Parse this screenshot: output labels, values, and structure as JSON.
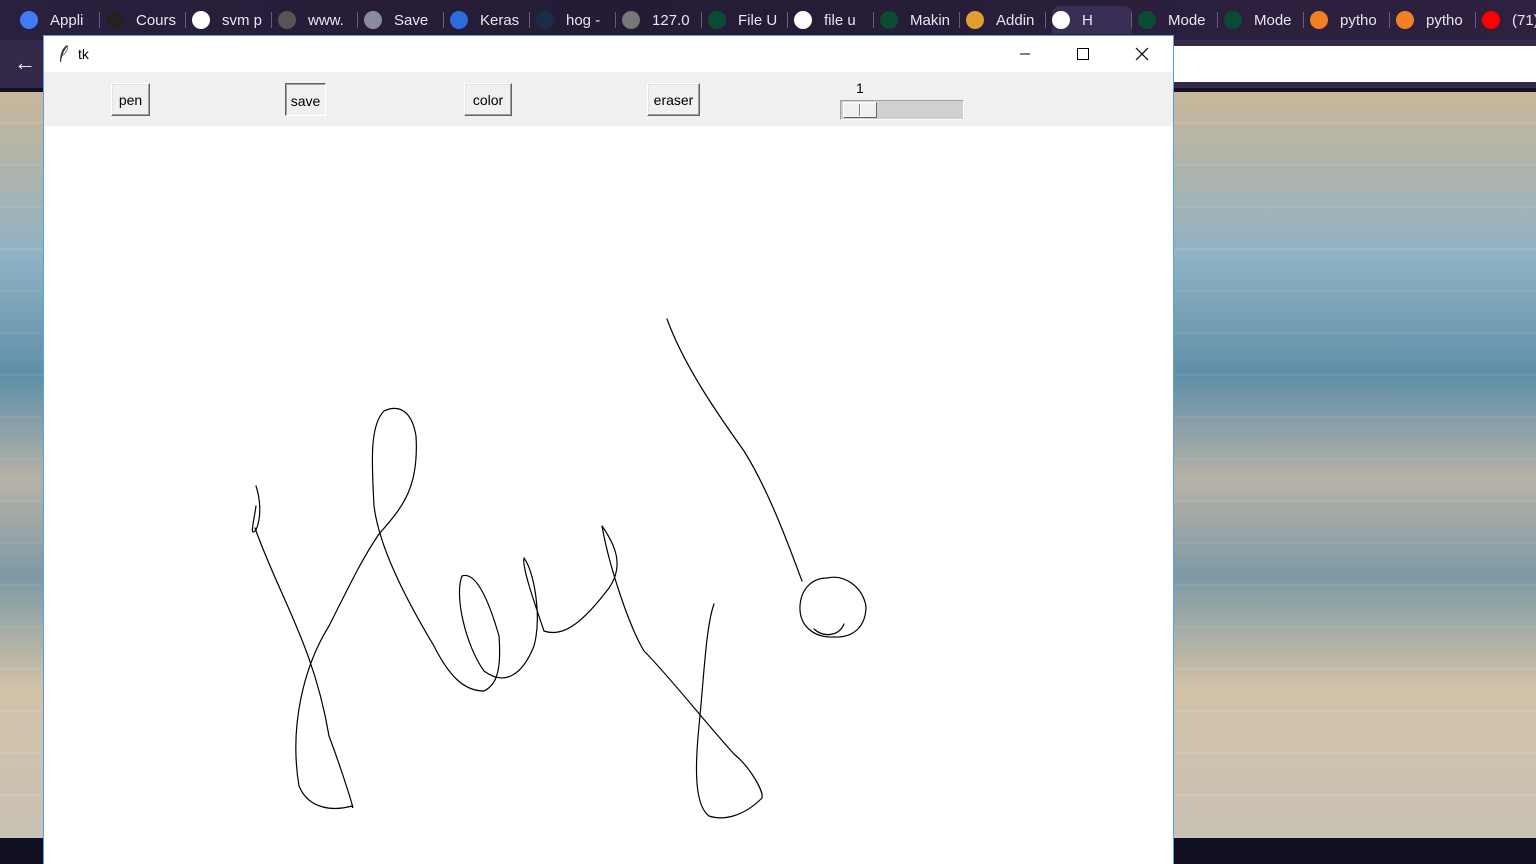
{
  "browser": {
    "tabs": [
      {
        "label": "Appli",
        "icon": "infinity-icon",
        "color": "#3d7bf7"
      },
      {
        "label": "Cours",
        "icon": "github-icon",
        "color": "#222222"
      },
      {
        "label": "svm p",
        "icon": "google-icon",
        "color": "#ffffff"
      },
      {
        "label": "www.",
        "icon": "k-icon",
        "color": "#555555"
      },
      {
        "label": "Save",
        "icon": "save-page-icon",
        "color": "#8a8aa0"
      },
      {
        "label": "Keras",
        "icon": "keras-icon",
        "color": "#2d6cdf"
      },
      {
        "label": "hog -",
        "icon": "person-icon",
        "color": "#1b2b4a"
      },
      {
        "label": "127.0",
        "icon": "globe-icon",
        "color": "#777777"
      },
      {
        "label": "File U",
        "icon": "django-icon",
        "color": "#0c4b33"
      },
      {
        "label": "file u",
        "icon": "google-icon",
        "color": "#ffffff"
      },
      {
        "label": "Makin",
        "icon": "django-icon",
        "color": "#0c4b33"
      },
      {
        "label": "Addin",
        "icon": "avatar-icon",
        "color": "#e0a030"
      },
      {
        "label": "H",
        "icon": "globe-icon",
        "color": "#ffffff",
        "active": true
      },
      {
        "label": "Mode",
        "icon": "django-icon",
        "color": "#0c4b33"
      },
      {
        "label": "Mode",
        "icon": "django-icon",
        "color": "#0c4b33"
      },
      {
        "label": "pytho",
        "icon": "stackoverflow-icon",
        "color": "#f48024"
      },
      {
        "label": "pytho",
        "icon": "stackoverflow-icon",
        "color": "#f48024"
      },
      {
        "label": "(71)",
        "icon": "youtube-icon",
        "color": "#ff0000"
      }
    ]
  },
  "window": {
    "title": "tk",
    "controls": {
      "minimize": "minimize",
      "maximize": "maximize",
      "close": "close"
    }
  },
  "toolbar": {
    "pen_label": "pen",
    "save_label": "save",
    "color_label": "color",
    "eraser_label": "eraser",
    "size_value": "1"
  },
  "canvas": {
    "background": "#ffffff",
    "stroke_color": "#000000",
    "pen_size": 1
  }
}
